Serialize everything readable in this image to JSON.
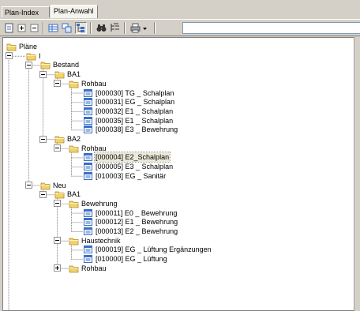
{
  "tabs": [
    {
      "label": "Plan-Index",
      "active": false
    },
    {
      "label": "Plan-Anwahl",
      "active": true
    }
  ],
  "toolbar": {
    "buttons": [
      {
        "name": "new-document-icon",
        "pressed": false
      },
      {
        "name": "expand-all-icon",
        "pressed": false
      },
      {
        "name": "collapse-all-icon",
        "pressed": false
      },
      {
        "name": "table-view-icon",
        "pressed": false
      },
      {
        "name": "list-view-icon",
        "pressed": false
      },
      {
        "name": "tree-view-icon",
        "pressed": true
      },
      {
        "name": "binoculars-search-icon",
        "pressed": false
      },
      {
        "name": "filter-tree-icon",
        "pressed": false
      },
      {
        "name": "printer-icon",
        "pressed": false
      },
      {
        "name": "dropdown-arrow-icon",
        "pressed": false
      }
    ],
    "search_value": ""
  },
  "tree": {
    "rows": [
      {
        "label": "Pläne",
        "type": "folder",
        "level": 0,
        "toggle": null
      },
      {
        "label": "I",
        "type": "folder",
        "level": 1,
        "toggle": "minus"
      },
      {
        "label": "Bestand",
        "type": "folder",
        "level": 2,
        "toggle": "minus"
      },
      {
        "label": "BA1",
        "type": "folder",
        "level": 3,
        "toggle": "minus"
      },
      {
        "label": "Rohbau",
        "type": "folder",
        "level": 4,
        "toggle": "minus"
      },
      {
        "label": "[000030] TG _ Schalplan",
        "type": "doc",
        "level": 5
      },
      {
        "label": "[000031] EG _ Schalplan",
        "type": "doc",
        "level": 5
      },
      {
        "label": "[000032] E1 _ Schalplan",
        "type": "doc",
        "level": 5
      },
      {
        "label": "[000035] E1 _ Schalplan",
        "type": "doc",
        "level": 5
      },
      {
        "label": "[000038] E3 _ Bewehrung",
        "type": "doc",
        "level": 5
      },
      {
        "label": "BA2",
        "type": "folder",
        "level": 3,
        "toggle": "minus"
      },
      {
        "label": "Rohbau",
        "type": "folder",
        "level": 4,
        "toggle": "minus"
      },
      {
        "label": "[000004] E2_Schalplan",
        "type": "doc",
        "level": 5,
        "selected": true
      },
      {
        "label": "[000005] E3 _ Schalplan",
        "type": "doc",
        "level": 5
      },
      {
        "label": "[010003] EG _ Sanitär",
        "type": "doc",
        "level": 5
      },
      {
        "label": "Neu",
        "type": "folder",
        "level": 2,
        "toggle": "minus"
      },
      {
        "label": "BA1",
        "type": "folder",
        "level": 3,
        "toggle": "minus"
      },
      {
        "label": "Bewehrung",
        "type": "folder",
        "level": 4,
        "toggle": "minus"
      },
      {
        "label": "[000011] E0 _ Bewehrung",
        "type": "doc",
        "level": 5
      },
      {
        "label": "[000012] E1 _ Bewehrung",
        "type": "doc",
        "level": 5
      },
      {
        "label": "[000013] E2 _ Bewehrung",
        "type": "doc",
        "level": 5
      },
      {
        "label": "Haustechnik",
        "type": "folder",
        "level": 4,
        "toggle": "minus"
      },
      {
        "label": "[000019] EG _ Lüftung Ergänzungen",
        "type": "doc",
        "level": 5
      },
      {
        "label": "[010000] EG _ Lüftung",
        "type": "doc",
        "level": 5
      },
      {
        "label": "Rohbau",
        "type": "folder",
        "level": 4,
        "toggle": "plus"
      }
    ]
  },
  "colors": {
    "folder": "#f2d26b",
    "folder_edge": "#b08c2a",
    "doc": "#3a6fc4",
    "line": "#808080"
  }
}
